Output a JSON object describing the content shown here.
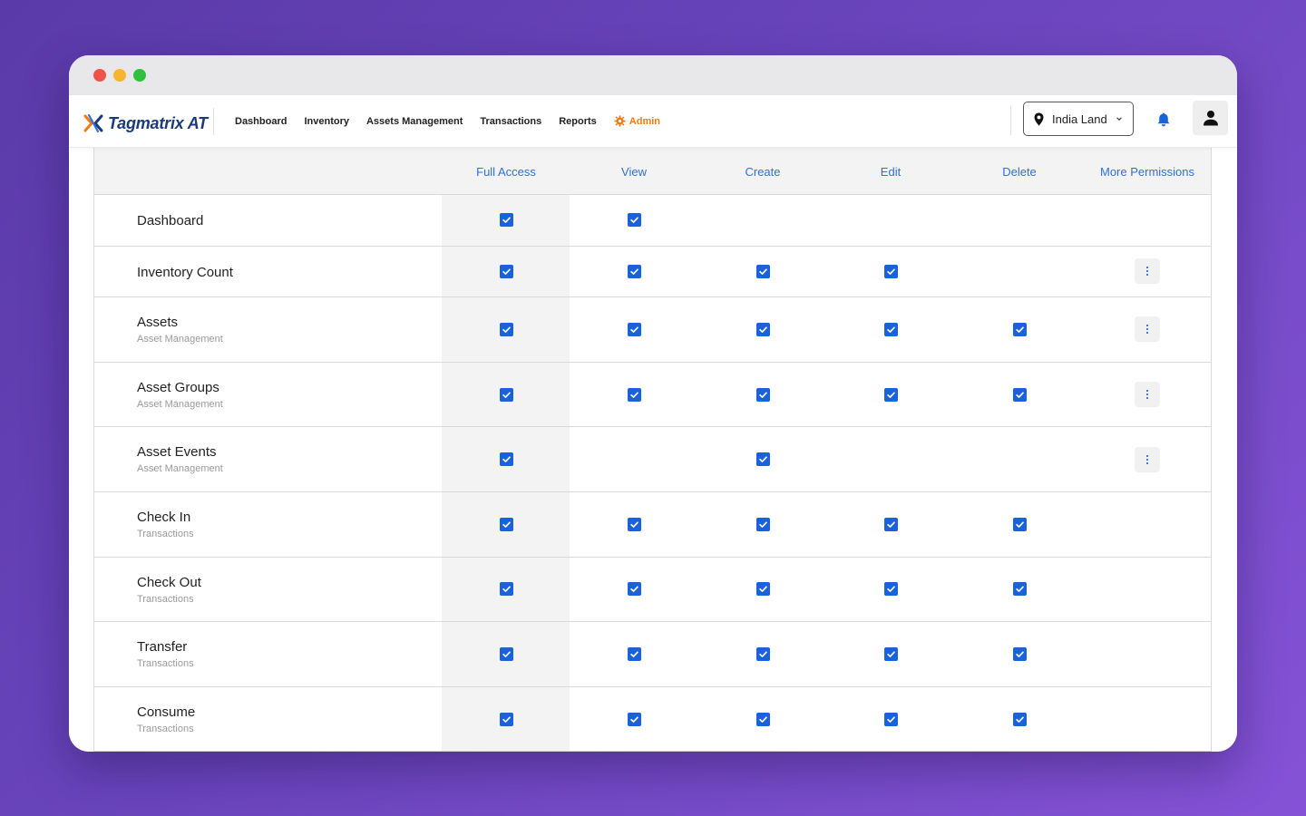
{
  "app": {
    "name": "Tagmatrix AT",
    "nav": [
      "Dashboard",
      "Inventory",
      "Assets Management",
      "Transactions",
      "Reports"
    ],
    "admin_label": "Admin",
    "location": "India Land",
    "accent_color": "#1a62dc",
    "admin_color": "#f07a12"
  },
  "table": {
    "columns": [
      "Full Access",
      "View",
      "Create",
      "Edit",
      "Delete",
      "More Permissions"
    ],
    "rows": [
      {
        "title": "Dashboard",
        "subtitle": "",
        "checks": [
          true,
          true,
          false,
          false,
          false
        ],
        "more": false
      },
      {
        "title": "Inventory Count",
        "subtitle": "",
        "checks": [
          true,
          true,
          true,
          true,
          false
        ],
        "more": true
      },
      {
        "title": "Assets",
        "subtitle": "Asset Management",
        "checks": [
          true,
          true,
          true,
          true,
          true
        ],
        "more": true
      },
      {
        "title": "Asset Groups",
        "subtitle": "Asset Management",
        "checks": [
          true,
          true,
          true,
          true,
          true
        ],
        "more": true
      },
      {
        "title": "Asset Events",
        "subtitle": "Asset Management",
        "checks": [
          true,
          false,
          true,
          false,
          false
        ],
        "more": true
      },
      {
        "title": "Check In",
        "subtitle": "Transactions",
        "checks": [
          true,
          true,
          true,
          true,
          true
        ],
        "more": false
      },
      {
        "title": "Check Out",
        "subtitle": "Transactions",
        "checks": [
          true,
          true,
          true,
          true,
          true
        ],
        "more": false
      },
      {
        "title": "Transfer",
        "subtitle": "Transactions",
        "checks": [
          true,
          true,
          true,
          true,
          true
        ],
        "more": false
      },
      {
        "title": "Consume",
        "subtitle": "Transactions",
        "checks": [
          true,
          true,
          true,
          true,
          true
        ],
        "more": false
      }
    ]
  }
}
